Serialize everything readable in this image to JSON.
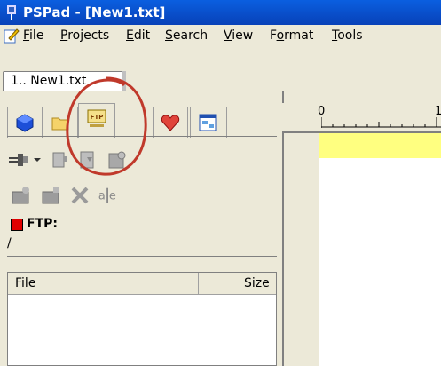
{
  "window": {
    "title": "PSPad - [New1.txt]"
  },
  "menu": {
    "items": [
      {
        "label": "File",
        "name": "menu-file"
      },
      {
        "label": "Projects",
        "name": "menu-projects"
      },
      {
        "label": "Edit",
        "name": "menu-edit"
      },
      {
        "label": "Search",
        "name": "menu-search"
      },
      {
        "label": "View",
        "name": "menu-view"
      },
      {
        "label": "Format",
        "name": "menu-format"
      },
      {
        "label": "Tools",
        "name": "menu-tools"
      }
    ]
  },
  "document_tabs": [
    {
      "label": "1.. New1.txt"
    }
  ],
  "panel_tabs": [
    {
      "icon": "projects-cube-icon"
    },
    {
      "icon": "folder-icon"
    },
    {
      "icon": "ftp-icon",
      "active": true
    },
    {
      "icon": "favorites-heart-icon"
    },
    {
      "icon": "window-list-icon"
    }
  ],
  "ftp": {
    "label": "FTP:",
    "path": "/",
    "indicator_color": "#e00000"
  },
  "file_list": {
    "columns": [
      "File",
      "Size"
    ]
  },
  "ruler": {
    "labels": [
      "0",
      "1"
    ]
  },
  "colors": {
    "title_bar": "#0a5fe0",
    "current_line": "#ffff80",
    "annotation": "#c0392b"
  }
}
